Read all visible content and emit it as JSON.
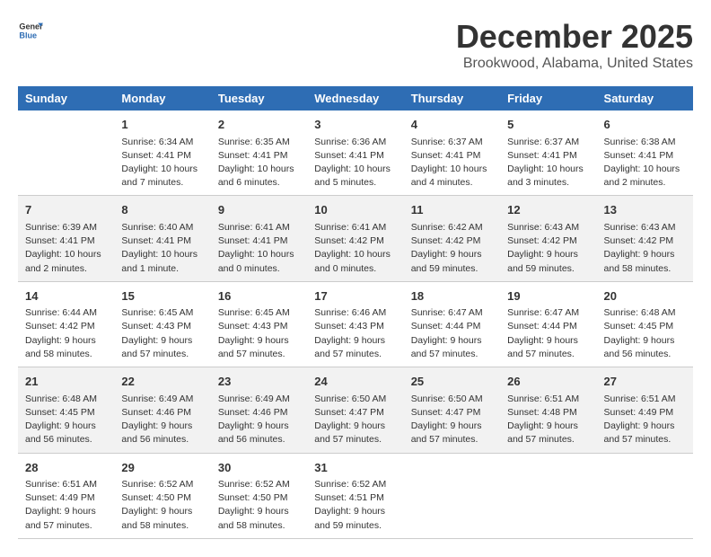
{
  "logo": {
    "general": "General",
    "blue": "Blue"
  },
  "title": "December 2025",
  "subtitle": "Brookwood, Alabama, United States",
  "days_header": [
    "Sunday",
    "Monday",
    "Tuesday",
    "Wednesday",
    "Thursday",
    "Friday",
    "Saturday"
  ],
  "weeks": [
    [
      {
        "day": "",
        "sunrise": "",
        "sunset": "",
        "daylight": ""
      },
      {
        "day": "1",
        "sunrise": "Sunrise: 6:34 AM",
        "sunset": "Sunset: 4:41 PM",
        "daylight": "Daylight: 10 hours and 7 minutes."
      },
      {
        "day": "2",
        "sunrise": "Sunrise: 6:35 AM",
        "sunset": "Sunset: 4:41 PM",
        "daylight": "Daylight: 10 hours and 6 minutes."
      },
      {
        "day": "3",
        "sunrise": "Sunrise: 6:36 AM",
        "sunset": "Sunset: 4:41 PM",
        "daylight": "Daylight: 10 hours and 5 minutes."
      },
      {
        "day": "4",
        "sunrise": "Sunrise: 6:37 AM",
        "sunset": "Sunset: 4:41 PM",
        "daylight": "Daylight: 10 hours and 4 minutes."
      },
      {
        "day": "5",
        "sunrise": "Sunrise: 6:37 AM",
        "sunset": "Sunset: 4:41 PM",
        "daylight": "Daylight: 10 hours and 3 minutes."
      },
      {
        "day": "6",
        "sunrise": "Sunrise: 6:38 AM",
        "sunset": "Sunset: 4:41 PM",
        "daylight": "Daylight: 10 hours and 2 minutes."
      }
    ],
    [
      {
        "day": "7",
        "sunrise": "Sunrise: 6:39 AM",
        "sunset": "Sunset: 4:41 PM",
        "daylight": "Daylight: 10 hours and 2 minutes."
      },
      {
        "day": "8",
        "sunrise": "Sunrise: 6:40 AM",
        "sunset": "Sunset: 4:41 PM",
        "daylight": "Daylight: 10 hours and 1 minute."
      },
      {
        "day": "9",
        "sunrise": "Sunrise: 6:41 AM",
        "sunset": "Sunset: 4:41 PM",
        "daylight": "Daylight: 10 hours and 0 minutes."
      },
      {
        "day": "10",
        "sunrise": "Sunrise: 6:41 AM",
        "sunset": "Sunset: 4:42 PM",
        "daylight": "Daylight: 10 hours and 0 minutes."
      },
      {
        "day": "11",
        "sunrise": "Sunrise: 6:42 AM",
        "sunset": "Sunset: 4:42 PM",
        "daylight": "Daylight: 9 hours and 59 minutes."
      },
      {
        "day": "12",
        "sunrise": "Sunrise: 6:43 AM",
        "sunset": "Sunset: 4:42 PM",
        "daylight": "Daylight: 9 hours and 59 minutes."
      },
      {
        "day": "13",
        "sunrise": "Sunrise: 6:43 AM",
        "sunset": "Sunset: 4:42 PM",
        "daylight": "Daylight: 9 hours and 58 minutes."
      }
    ],
    [
      {
        "day": "14",
        "sunrise": "Sunrise: 6:44 AM",
        "sunset": "Sunset: 4:42 PM",
        "daylight": "Daylight: 9 hours and 58 minutes."
      },
      {
        "day": "15",
        "sunrise": "Sunrise: 6:45 AM",
        "sunset": "Sunset: 4:43 PM",
        "daylight": "Daylight: 9 hours and 57 minutes."
      },
      {
        "day": "16",
        "sunrise": "Sunrise: 6:45 AM",
        "sunset": "Sunset: 4:43 PM",
        "daylight": "Daylight: 9 hours and 57 minutes."
      },
      {
        "day": "17",
        "sunrise": "Sunrise: 6:46 AM",
        "sunset": "Sunset: 4:43 PM",
        "daylight": "Daylight: 9 hours and 57 minutes."
      },
      {
        "day": "18",
        "sunrise": "Sunrise: 6:47 AM",
        "sunset": "Sunset: 4:44 PM",
        "daylight": "Daylight: 9 hours and 57 minutes."
      },
      {
        "day": "19",
        "sunrise": "Sunrise: 6:47 AM",
        "sunset": "Sunset: 4:44 PM",
        "daylight": "Daylight: 9 hours and 57 minutes."
      },
      {
        "day": "20",
        "sunrise": "Sunrise: 6:48 AM",
        "sunset": "Sunset: 4:45 PM",
        "daylight": "Daylight: 9 hours and 56 minutes."
      }
    ],
    [
      {
        "day": "21",
        "sunrise": "Sunrise: 6:48 AM",
        "sunset": "Sunset: 4:45 PM",
        "daylight": "Daylight: 9 hours and 56 minutes."
      },
      {
        "day": "22",
        "sunrise": "Sunrise: 6:49 AM",
        "sunset": "Sunset: 4:46 PM",
        "daylight": "Daylight: 9 hours and 56 minutes."
      },
      {
        "day": "23",
        "sunrise": "Sunrise: 6:49 AM",
        "sunset": "Sunset: 4:46 PM",
        "daylight": "Daylight: 9 hours and 56 minutes."
      },
      {
        "day": "24",
        "sunrise": "Sunrise: 6:50 AM",
        "sunset": "Sunset: 4:47 PM",
        "daylight": "Daylight: 9 hours and 57 minutes."
      },
      {
        "day": "25",
        "sunrise": "Sunrise: 6:50 AM",
        "sunset": "Sunset: 4:47 PM",
        "daylight": "Daylight: 9 hours and 57 minutes."
      },
      {
        "day": "26",
        "sunrise": "Sunrise: 6:51 AM",
        "sunset": "Sunset: 4:48 PM",
        "daylight": "Daylight: 9 hours and 57 minutes."
      },
      {
        "day": "27",
        "sunrise": "Sunrise: 6:51 AM",
        "sunset": "Sunset: 4:49 PM",
        "daylight": "Daylight: 9 hours and 57 minutes."
      }
    ],
    [
      {
        "day": "28",
        "sunrise": "Sunrise: 6:51 AM",
        "sunset": "Sunset: 4:49 PM",
        "daylight": "Daylight: 9 hours and 57 minutes."
      },
      {
        "day": "29",
        "sunrise": "Sunrise: 6:52 AM",
        "sunset": "Sunset: 4:50 PM",
        "daylight": "Daylight: 9 hours and 58 minutes."
      },
      {
        "day": "30",
        "sunrise": "Sunrise: 6:52 AM",
        "sunset": "Sunset: 4:50 PM",
        "daylight": "Daylight: 9 hours and 58 minutes."
      },
      {
        "day": "31",
        "sunrise": "Sunrise: 6:52 AM",
        "sunset": "Sunset: 4:51 PM",
        "daylight": "Daylight: 9 hours and 59 minutes."
      },
      {
        "day": "",
        "sunrise": "",
        "sunset": "",
        "daylight": ""
      },
      {
        "day": "",
        "sunrise": "",
        "sunset": "",
        "daylight": ""
      },
      {
        "day": "",
        "sunrise": "",
        "sunset": "",
        "daylight": ""
      }
    ]
  ]
}
